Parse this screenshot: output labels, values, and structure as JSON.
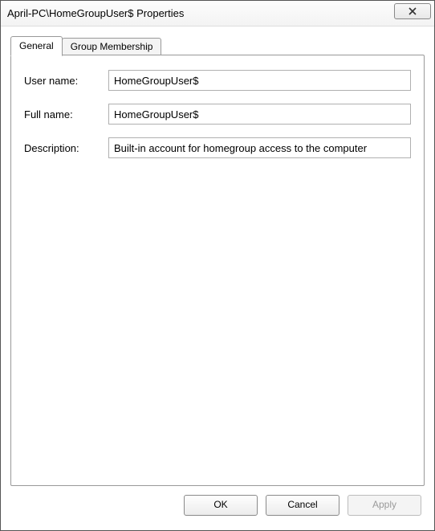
{
  "window": {
    "title": "April-PC\\HomeGroupUser$ Properties"
  },
  "tabs": [
    {
      "label": "General",
      "active": true
    },
    {
      "label": "Group Membership",
      "active": false
    }
  ],
  "fields": {
    "username_label": "User name:",
    "username_value": "HomeGroupUser$",
    "fullname_label": "Full name:",
    "fullname_value": "HomeGroupUser$",
    "description_label": "Description:",
    "description_value": "Built-in account for homegroup access to the computer"
  },
  "buttons": {
    "ok": "OK",
    "cancel": "Cancel",
    "apply": "Apply"
  }
}
